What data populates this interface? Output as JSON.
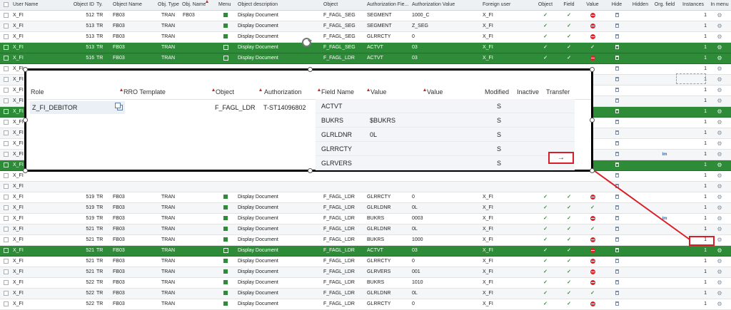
{
  "headers": [
    "User Name",
    "Object ID",
    "Ty.",
    "Object Name",
    "Obj. Type",
    "Obj. Name",
    "Menu",
    "Object description",
    "Object",
    "Authorization Fie...",
    "Authorization Value",
    "Foreign user",
    "Object",
    "Field",
    "Value",
    "Hide",
    "Hidden",
    "Org. field",
    "Instances",
    "In menu"
  ],
  "rows": [
    {
      "user": "X_FI",
      "id": "512",
      "ty": "TR",
      "name": "FB03",
      "type": "TRAN",
      "oname": "FB03",
      "desc": "Display Document",
      "obj": "F_FAGL_SEG",
      "field": "SEGMENT",
      "value": "1000_C",
      "fuser": "X_FI",
      "inst": "1",
      "state": "n",
      "v": "stop"
    },
    {
      "user": "X_FI",
      "id": "513",
      "ty": "TR",
      "name": "FB03",
      "type": "TRAN",
      "oname": "",
      "desc": "Display Document",
      "obj": "F_FAGL_SEG",
      "field": "SEGMENT",
      "value": "Z_SEG",
      "fuser": "X_FI",
      "inst": "1",
      "state": "a",
      "v": "stop"
    },
    {
      "user": "X_FI",
      "id": "513",
      "ty": "TR",
      "name": "FB03",
      "type": "TRAN",
      "oname": "",
      "desc": "Display Document",
      "obj": "F_FAGL_SEG",
      "field": "GLRRCTY",
      "value": "0",
      "fuser": "X_FI",
      "inst": "1",
      "state": "n",
      "v": "stop"
    },
    {
      "user": "X_FI",
      "id": "513",
      "ty": "TR",
      "name": "FB03",
      "type": "TRAN",
      "oname": "",
      "desc": "Display Document",
      "obj": "F_FAGL_SEG",
      "field": "ACTVT",
      "value": "03",
      "fuser": "X_FI",
      "inst": "1",
      "state": "h",
      "v": "check"
    },
    {
      "user": "X_FI",
      "id": "516",
      "ty": "TR",
      "name": "FB03",
      "type": "TRAN",
      "oname": "",
      "desc": "Display Document",
      "obj": "F_FAGL_LDR",
      "field": "ACTVT",
      "value": "03",
      "fuser": "X_FI",
      "inst": "1",
      "state": "h",
      "v": "stop"
    },
    {
      "user": "X_FI",
      "id": "",
      "ty": "",
      "name": "",
      "type": "",
      "oname": "",
      "desc": "",
      "obj": "",
      "field": "",
      "value": "",
      "fuser": "",
      "inst": "1",
      "state": "n",
      "v": ""
    },
    {
      "user": "X_FI",
      "id": "",
      "ty": "",
      "name": "",
      "type": "",
      "oname": "",
      "desc": "",
      "obj": "",
      "field": "",
      "value": "",
      "fuser": "",
      "inst": "1",
      "state": "a",
      "v": ""
    },
    {
      "user": "X_FI",
      "id": "",
      "ty": "",
      "name": "",
      "type": "",
      "oname": "",
      "desc": "",
      "obj": "",
      "field": "",
      "value": "",
      "fuser": "",
      "inst": "1",
      "state": "n",
      "v": ""
    },
    {
      "user": "X_FI",
      "id": "",
      "ty": "",
      "name": "",
      "type": "",
      "oname": "",
      "desc": "",
      "obj": "",
      "field": "",
      "value": "",
      "fuser": "",
      "inst": "1",
      "state": "a",
      "v": ""
    },
    {
      "user": "X_FI",
      "id": "",
      "ty": "",
      "name": "",
      "type": "",
      "oname": "",
      "desc": "",
      "obj": "",
      "field": "",
      "value": "",
      "fuser": "",
      "inst": "1",
      "state": "h",
      "v": ""
    },
    {
      "user": "X_FI",
      "id": "",
      "ty": "",
      "name": "",
      "type": "",
      "oname": "",
      "desc": "",
      "obj": "",
      "field": "",
      "value": "",
      "fuser": "",
      "inst": "1",
      "state": "n",
      "v": ""
    },
    {
      "user": "X_FI",
      "id": "",
      "ty": "",
      "name": "",
      "type": "",
      "oname": "",
      "desc": "",
      "obj": "",
      "field": "",
      "value": "",
      "fuser": "",
      "inst": "1",
      "state": "a",
      "v": ""
    },
    {
      "user": "X_FI",
      "id": "",
      "ty": "",
      "name": "",
      "type": "",
      "oname": "",
      "desc": "",
      "obj": "",
      "field": "",
      "value": "",
      "fuser": "",
      "inst": "1",
      "state": "n",
      "v": ""
    },
    {
      "user": "X_FI",
      "id": "",
      "ty": "",
      "name": "",
      "type": "",
      "oname": "",
      "desc": "",
      "obj": "",
      "field": "",
      "value": "",
      "fuser": "",
      "inst": "1",
      "state": "a",
      "v": ""
    },
    {
      "user": "X_FI",
      "id": "",
      "ty": "",
      "name": "",
      "type": "",
      "oname": "",
      "desc": "",
      "obj": "",
      "field": "",
      "value": "",
      "fuser": "",
      "inst": "1",
      "state": "h",
      "v": ""
    },
    {
      "user": "X_FI",
      "id": "",
      "ty": "",
      "name": "",
      "type": "",
      "oname": "",
      "desc": "",
      "obj": "",
      "field": "",
      "value": "",
      "fuser": "",
      "inst": "1",
      "state": "n",
      "v": ""
    },
    {
      "user": "X_FI",
      "id": "",
      "ty": "",
      "name": "",
      "type": "",
      "oname": "",
      "desc": "",
      "obj": "",
      "field": "",
      "value": "",
      "fuser": "",
      "inst": "1",
      "state": "a",
      "v": ""
    },
    {
      "user": "X_FI",
      "id": "519",
      "ty": "TR",
      "name": "FB03",
      "type": "TRAN",
      "oname": "",
      "desc": "Display Document",
      "obj": "F_FAGL_LDR",
      "field": "GLRRCTY",
      "value": "0",
      "fuser": "X_FI",
      "inst": "1",
      "state": "n",
      "v": "stop"
    },
    {
      "user": "X_FI",
      "id": "519",
      "ty": "TR",
      "name": "FB03",
      "type": "TRAN",
      "oname": "",
      "desc": "Display Document",
      "obj": "F_FAGL_LDR",
      "field": "GLRLDNR",
      "value": "0L",
      "fuser": "X_FI",
      "inst": "1",
      "state": "a",
      "v": "check"
    },
    {
      "user": "X_FI",
      "id": "519",
      "ty": "TR",
      "name": "FB03",
      "type": "TRAN",
      "oname": "",
      "desc": "Display Document",
      "obj": "F_FAGL_LDR",
      "field": "BUKRS",
      "value": "0003",
      "fuser": "X_FI",
      "inst": "1",
      "state": "n",
      "v": "stop"
    },
    {
      "user": "X_FI",
      "id": "521",
      "ty": "TR",
      "name": "FB03",
      "type": "TRAN",
      "oname": "",
      "desc": "Display Document",
      "obj": "F_FAGL_LDR",
      "field": "GLRLDNR",
      "value": "0L",
      "fuser": "X_FI",
      "inst": "1",
      "state": "a",
      "v": "check"
    },
    {
      "user": "X_FI",
      "id": "521",
      "ty": "TR",
      "name": "FB03",
      "type": "TRAN",
      "oname": "",
      "desc": "Display Document",
      "obj": "F_FAGL_LDR",
      "field": "BUKRS",
      "value": "1000",
      "fuser": "X_FI",
      "inst": "1",
      "state": "n",
      "v": "stop"
    },
    {
      "user": "X_FI",
      "id": "521",
      "ty": "TR",
      "name": "FB03",
      "type": "TRAN",
      "oname": "",
      "desc": "Display Document",
      "obj": "F_FAGL_LDR",
      "field": "ACTVT",
      "value": "03",
      "fuser": "X_FI",
      "inst": "1",
      "state": "h",
      "v": "stop"
    },
    {
      "user": "X_FI",
      "id": "521",
      "ty": "TR",
      "name": "FB03",
      "type": "TRAN",
      "oname": "",
      "desc": "Display Document",
      "obj": "F_FAGL_LDR",
      "field": "GLRRCTY",
      "value": "0",
      "fuser": "X_FI",
      "inst": "1",
      "state": "n",
      "v": "stop"
    },
    {
      "user": "X_FI",
      "id": "521",
      "ty": "TR",
      "name": "FB03",
      "type": "TRAN",
      "oname": "",
      "desc": "Display Document",
      "obj": "F_FAGL_LDR",
      "field": "GLRVERS",
      "value": "001",
      "fuser": "X_FI",
      "inst": "1",
      "state": "a",
      "v": "stop"
    },
    {
      "user": "X_FI",
      "id": "522",
      "ty": "TR",
      "name": "FB03",
      "type": "TRAN",
      "oname": "",
      "desc": "Display Document",
      "obj": "F_FAGL_LDR",
      "field": "BUKRS",
      "value": "1010",
      "fuser": "X_FI",
      "inst": "1",
      "state": "n",
      "v": "stop"
    },
    {
      "user": "X_FI",
      "id": "522",
      "ty": "TR",
      "name": "FB03",
      "type": "TRAN",
      "oname": "",
      "desc": "Display Document",
      "obj": "F_FAGL_LDR",
      "field": "GLRLDNR",
      "value": "0L",
      "fuser": "X_FI",
      "inst": "1",
      "state": "a",
      "v": "check"
    },
    {
      "user": "X_FI",
      "id": "522",
      "ty": "TR",
      "name": "FB03",
      "type": "TRAN",
      "oname": "",
      "desc": "Display Document",
      "obj": "F_FAGL_LDR",
      "field": "GLRRCTY",
      "value": "0",
      "fuser": "X_FI",
      "inst": "1",
      "state": "n",
      "v": "stop"
    }
  ],
  "overlay": {
    "headers": [
      "Role",
      "RRO Template",
      "Object",
      "Authorization",
      "Field Name",
      "Value",
      "Value",
      "Modified",
      "Inactive",
      "Transfer"
    ],
    "role": "Z_FI_DEBITOR",
    "object": "F_FAGL_LDR",
    "authorization": "T-ST14096802",
    "fields": [
      {
        "name": "ACTVT",
        "value": "",
        "modified": ""
      },
      {
        "name": "BUKRS",
        "value": "$BUKRS",
        "modified": "S"
      },
      {
        "name": "GLRLDNR",
        "value": "0L",
        "modified": "S"
      },
      {
        "name": "GLRRCTY",
        "value": "",
        "modified": "S"
      },
      {
        "name": "GLRVERS",
        "value": "",
        "modified": "S"
      }
    ],
    "first_modified": "S",
    "transfer_glyph": "→"
  },
  "colors": {
    "highlight": "#2e8b38",
    "accent_red": "#d81f26"
  }
}
